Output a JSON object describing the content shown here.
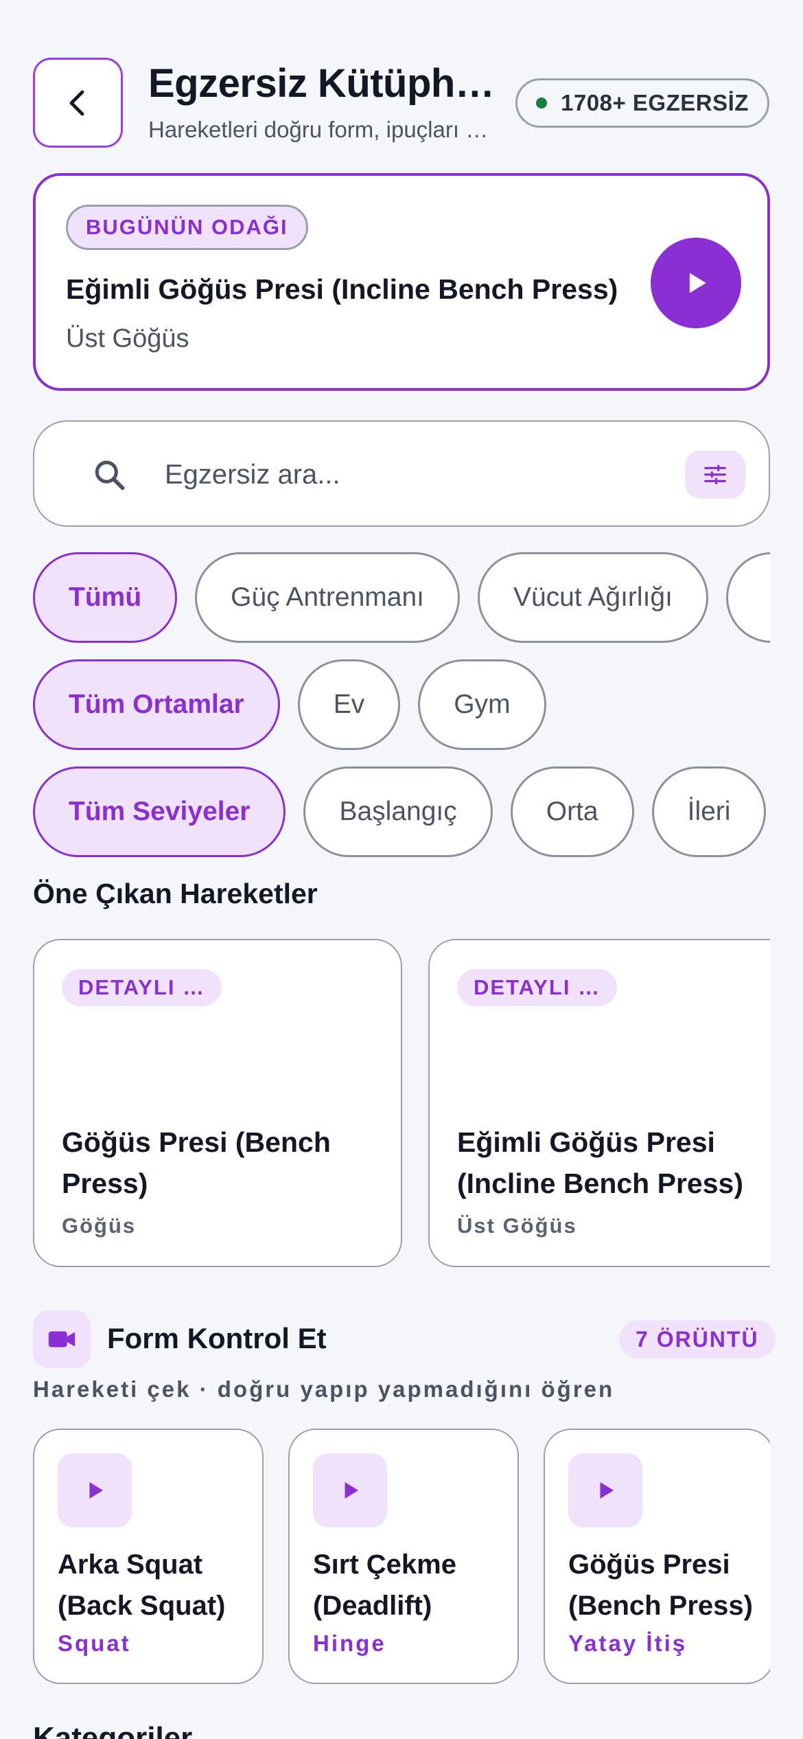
{
  "header": {
    "title": "Egzersiz Kütüphanesi",
    "subtitle": "Hareketleri doğru form, ipuçları ve videolarla öğren",
    "count_badge": "1708+ EGZERSİZ"
  },
  "focus": {
    "tag": "BUGÜNÜN ODAĞI",
    "title": "Eğimli Göğüs Presi (Incline Bench Press)",
    "subtitle": "Üst Göğüs"
  },
  "search": {
    "placeholder": "Egzersiz ara..."
  },
  "filters": {
    "types": [
      {
        "label": "Tümü",
        "active": true
      },
      {
        "label": "Güç Antrenmanı",
        "active": false
      },
      {
        "label": "Vücut Ağırlığı",
        "active": false
      },
      {
        "label": "",
        "active": false
      }
    ],
    "environments": [
      {
        "label": "Tüm Ortamlar",
        "active": true
      },
      {
        "label": "Ev",
        "active": false
      },
      {
        "label": "Gym",
        "active": false
      }
    ],
    "levels": [
      {
        "label": "Tüm Seviyeler",
        "active": true
      },
      {
        "label": "Başlangıç",
        "active": false
      },
      {
        "label": "Orta",
        "active": false
      },
      {
        "label": "İleri",
        "active": false
      }
    ]
  },
  "featured": {
    "heading": "Öne Çıkan Hareketler",
    "items": [
      {
        "tag": "DETAYLI …",
        "title": "Göğüs Presi (Bench Press)",
        "muscle": "Göğüs"
      },
      {
        "tag": "DETAYLI …",
        "title": "Eğimli Göğüs Presi (Incline Bench Press)",
        "muscle": "Üst Göğüs"
      }
    ]
  },
  "form_check": {
    "title": "Form Kontrol Et",
    "badge": "7 ÖRÜNTÜ",
    "subtitle": "Hareketi çek · doğru yapıp yapmadığını öğren",
    "patterns": [
      {
        "title": "Arka Squat (Back Squat)",
        "pattern": "Squat"
      },
      {
        "title": "Sırt Çekme (Deadlift)",
        "pattern": "Hinge"
      },
      {
        "title": "Göğüs Presi (Bench Press)",
        "pattern": "Yatay İtiş"
      }
    ]
  },
  "next_section": {
    "heading": "Kategoriler"
  },
  "colors": {
    "accent": "#8a2fd4",
    "accent_soft": "#efe2fa",
    "status_dot": "#17803d"
  }
}
